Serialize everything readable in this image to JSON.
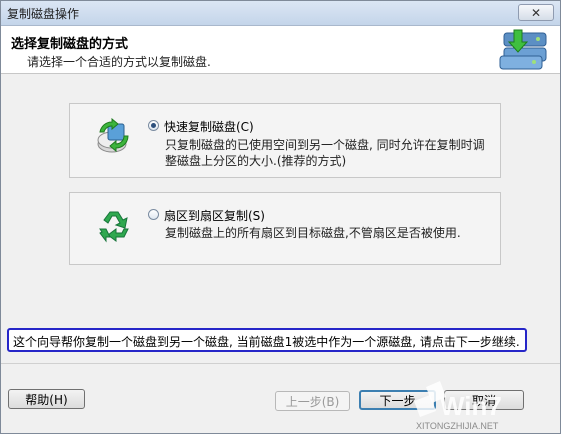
{
  "window": {
    "title": "复制磁盘操作",
    "close_glyph": "✕"
  },
  "header": {
    "title": "选择复制磁盘的方式",
    "subtitle": "请选择一个合适的方式以复制磁盘.",
    "icon": "disk-copy-icon"
  },
  "options": [
    {
      "label": "快速复制磁盘(C)",
      "description": "只复制磁盘的已使用空间到另一个磁盘, 同时允许在复制时调整磁盘上分区的大小.(推荐的方式)",
      "checked": true,
      "icon": "fast-copy-icon"
    },
    {
      "label": "扇区到扇区复制(S)",
      "description": "复制磁盘上的所有扇区到目标磁盘,不管扇区是否被使用.",
      "checked": false,
      "icon": "recycle-icon"
    }
  ],
  "info": {
    "text": "这个向导帮你复制一个磁盘到另一个磁盘, 当前磁盘1被选中作为一个源磁盘, 请点击下一步继续."
  },
  "footer": {
    "help_label": "帮助(H)",
    "back_label": "上一步(B)",
    "next_label": "下一步",
    "cancel_label": "取消"
  },
  "watermark": {
    "brand": "Win7系统之家",
    "url": "XITONGZHIJIA.NET"
  }
}
